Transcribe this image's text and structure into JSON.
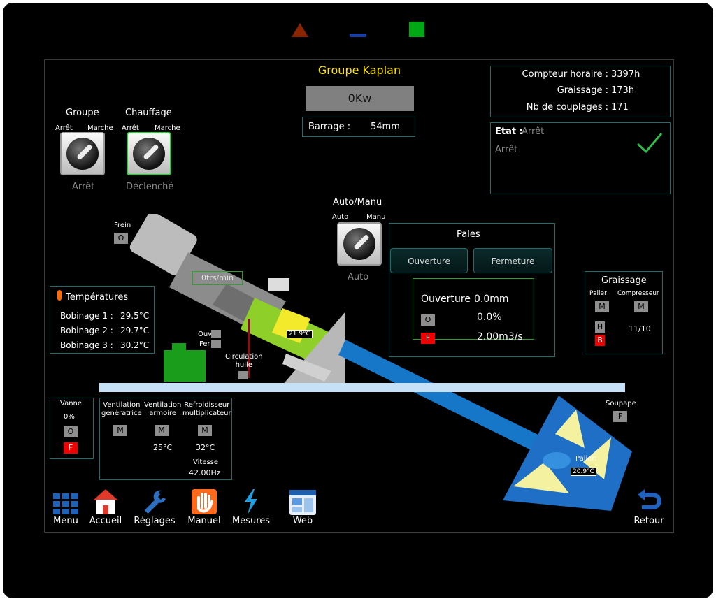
{
  "top_indicators": {
    "alarm_color": "#8b2500",
    "mid_color": "#1a3fa0",
    "ok_color": "#00a814"
  },
  "header": {
    "title": "Groupe Kaplan",
    "power": "0Kw",
    "barrage_label": "Barrage :",
    "barrage_value": "54mm"
  },
  "counters": {
    "horaire_label": "Compteur horaire :",
    "horaire_value": "3397h",
    "graissage_label": "Graissage :",
    "graissage_value": "173h",
    "couplages_label": "Nb de couplages :",
    "couplages_value": "171"
  },
  "etat": {
    "label": "Etat :",
    "value": "Arrêt",
    "detail": "Arrêt"
  },
  "groupe": {
    "title": "Groupe",
    "left": "Arrêt",
    "right": "Marche",
    "status": "Arrêt"
  },
  "chauffage": {
    "title": "Chauffage",
    "left": "Arrêt",
    "right": "Marche",
    "status": "Déclenché"
  },
  "automanu": {
    "title": "Auto/Manu",
    "left": "Auto",
    "right": "Manu",
    "status": "Auto"
  },
  "frein": {
    "label": "Frein",
    "btn": "O"
  },
  "speed": "0trs/min",
  "temperatures": {
    "title": "Températures",
    "rows": [
      {
        "label": "Bobinage 1 :",
        "value": "29.5°C"
      },
      {
        "label": "Bobinage 2 :",
        "value": "29.7°C"
      },
      {
        "label": "Bobinage 3 :",
        "value": "30.2°C"
      }
    ]
  },
  "machine": {
    "ouv": "Ouv",
    "fer": "Fer",
    "temp": "21.9°C",
    "circulation": "Circulation\nhuile"
  },
  "pales": {
    "title": "Pales",
    "ouverture_btn": "Ouverture",
    "fermeture_btn": "Fermeture",
    "ouverture_label": "Ouverture :",
    "ouverture_mm": "0.0mm",
    "pct": "0.0%",
    "flow": "2.00m3/s",
    "o": "O",
    "f": "F"
  },
  "graissage": {
    "title": "Graissage",
    "palier": "Palier",
    "compresseur": "Compresseur",
    "m": "M",
    "h": "H",
    "b": "B",
    "ratio": "11/10"
  },
  "vanne": {
    "title": "Vanne",
    "pct": "0%",
    "o": "O",
    "f": "F"
  },
  "ventilation": {
    "gen_label": "Ventilation\ngénératrice",
    "arm_label": "Ventilation\narmoire",
    "ref_label": "Refroidisseur\nmultiplicateur",
    "m": "M",
    "arm_temp": "25°C",
    "ref_temp": "32°C",
    "vitesse_label": "Vitesse",
    "vitesse_value": "42.00Hz"
  },
  "soupape": {
    "label": "Soupape",
    "btn": "F"
  },
  "turbine": {
    "palier_label": "Palier:",
    "palier_temp": "20.9°C"
  },
  "nav": {
    "menu": "Menu",
    "accueil": "Accueil",
    "reglages": "Réglages",
    "manuel": "Manuel",
    "mesures": "Mesures",
    "web": "Web",
    "retour": "Retour"
  }
}
